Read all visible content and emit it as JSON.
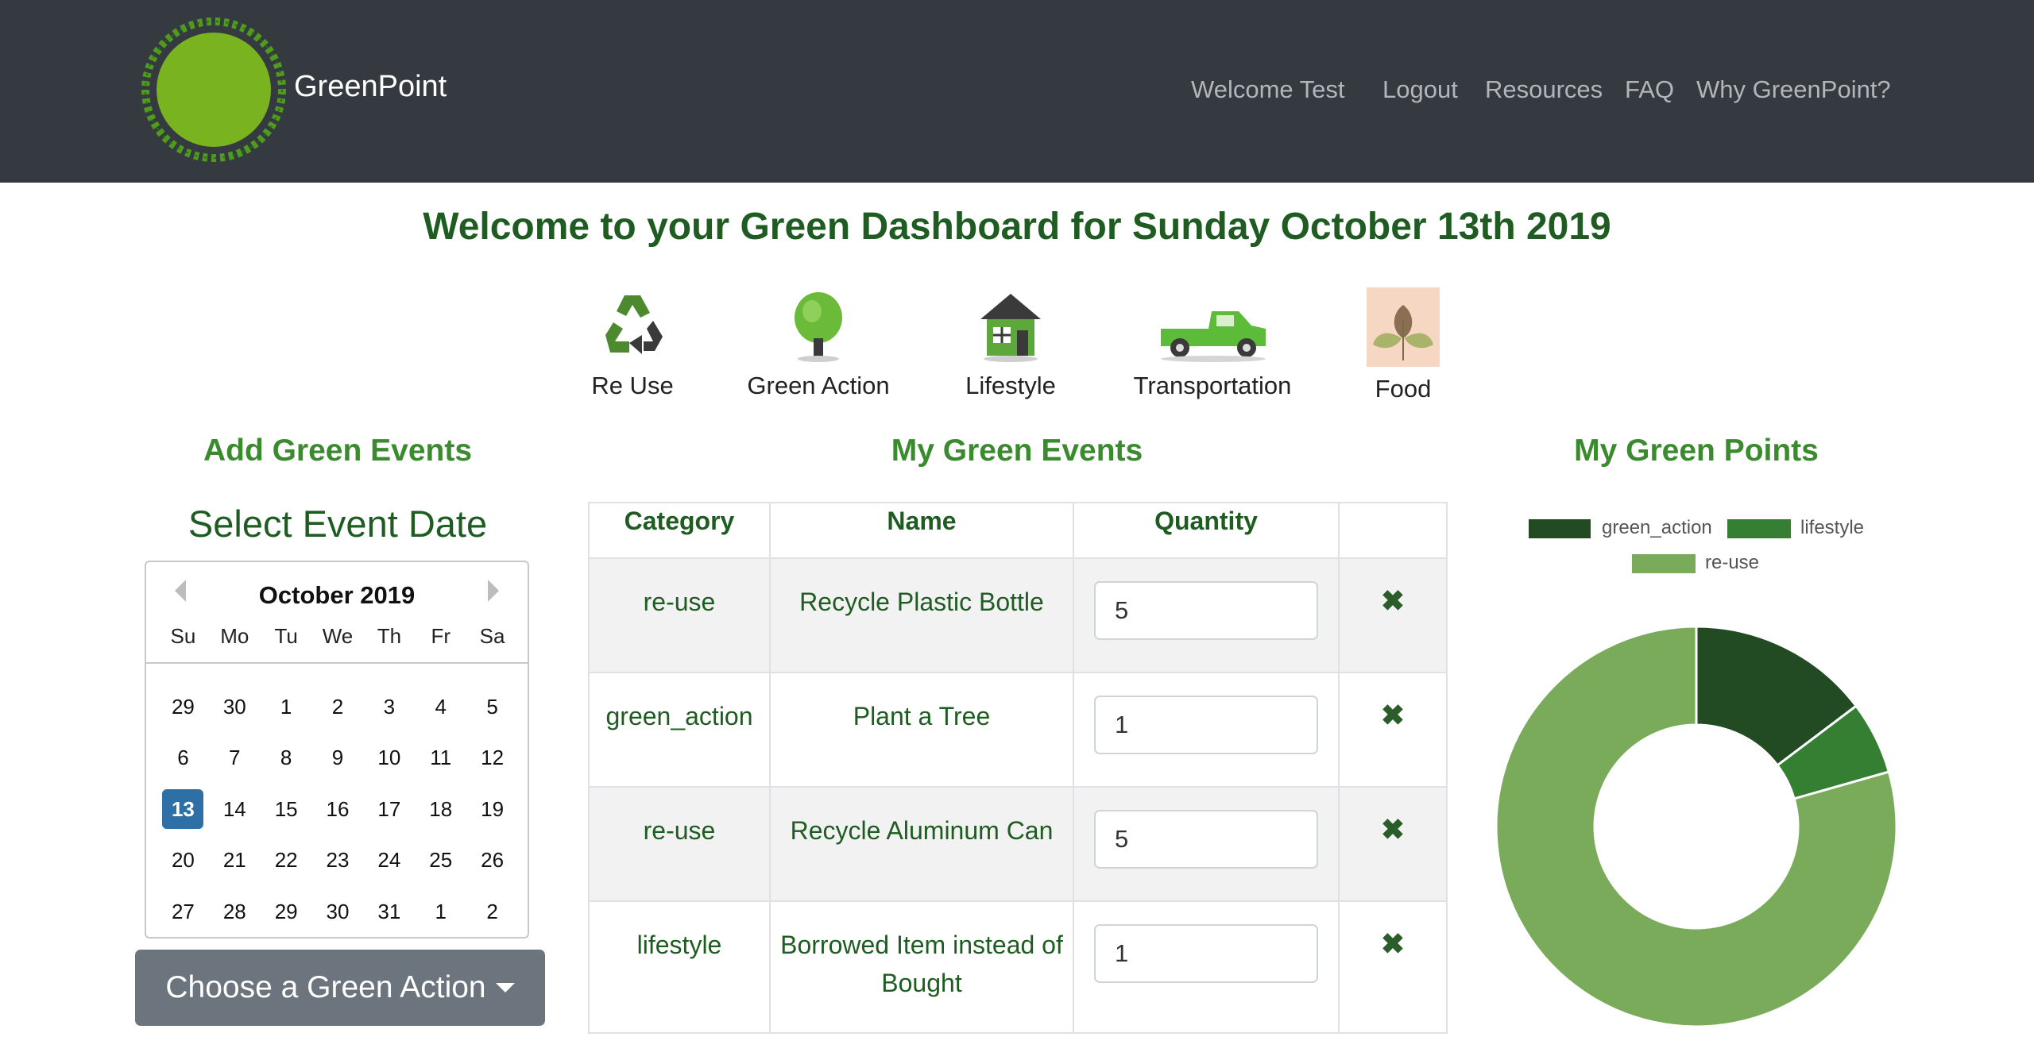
{
  "brand": {
    "name": "GreenPoint"
  },
  "nav": {
    "welcome": "Welcome Test",
    "logout": "Logout",
    "resources": "Resources",
    "faq": "FAQ",
    "why": "Why GreenPoint?"
  },
  "page_title": "Welcome to your Green Dashboard for Sunday October 13th 2019",
  "categories": [
    {
      "label": "Re Use",
      "icon": "recycle-icon"
    },
    {
      "label": "Green Action",
      "icon": "tree-icon"
    },
    {
      "label": "Lifestyle",
      "icon": "house-icon"
    },
    {
      "label": "Transportation",
      "icon": "truck-icon"
    },
    {
      "label": "Food",
      "icon": "leaves-icon"
    }
  ],
  "add_section": {
    "heading": "Add Green Events",
    "subheading": "Select Event Date",
    "dropdown_label": "Choose a Green Action"
  },
  "calendar": {
    "title": "October 2019",
    "weekdays": [
      "Su",
      "Mo",
      "Tu",
      "We",
      "Th",
      "Fr",
      "Sa"
    ],
    "weeks": [
      [
        "29",
        "30",
        "1",
        "2",
        "3",
        "4",
        "5"
      ],
      [
        "6",
        "7",
        "8",
        "9",
        "10",
        "11",
        "12"
      ],
      [
        "13",
        "14",
        "15",
        "16",
        "17",
        "18",
        "19"
      ],
      [
        "20",
        "21",
        "22",
        "23",
        "24",
        "25",
        "26"
      ],
      [
        "27",
        "28",
        "29",
        "30",
        "31",
        "1",
        "2"
      ]
    ],
    "selected": "13"
  },
  "events_section": {
    "heading": "My Green Events",
    "columns": [
      "Category",
      "Name",
      "Quantity",
      ""
    ],
    "rows": [
      {
        "category": "re-use",
        "name": "Recycle Plastic Bottle",
        "quantity": "5"
      },
      {
        "category": "green_action",
        "name": "Plant a Tree",
        "quantity": "1"
      },
      {
        "category": "re-use",
        "name": "Recycle Aluminum Can",
        "quantity": "5"
      },
      {
        "category": "lifestyle",
        "name": "Borrowed Item instead of Bought",
        "quantity": "1"
      }
    ],
    "delete_glyph": "✖"
  },
  "points_section": {
    "heading": "My Green Points"
  },
  "chart_data": {
    "type": "pie",
    "donut": true,
    "labels": [
      "green_action",
      "lifestyle",
      "re-use"
    ],
    "values": [
      1,
      0.4,
      5.4
    ],
    "colors": [
      "#234b23",
      "#357f32",
      "#79ab5a"
    ],
    "legend_position": "top"
  },
  "colors": {
    "navbar": "#343a40",
    "accent_dark": "#1e5c22",
    "accent": "#3a8a2e",
    "selected_date": "#2e6fa6"
  }
}
